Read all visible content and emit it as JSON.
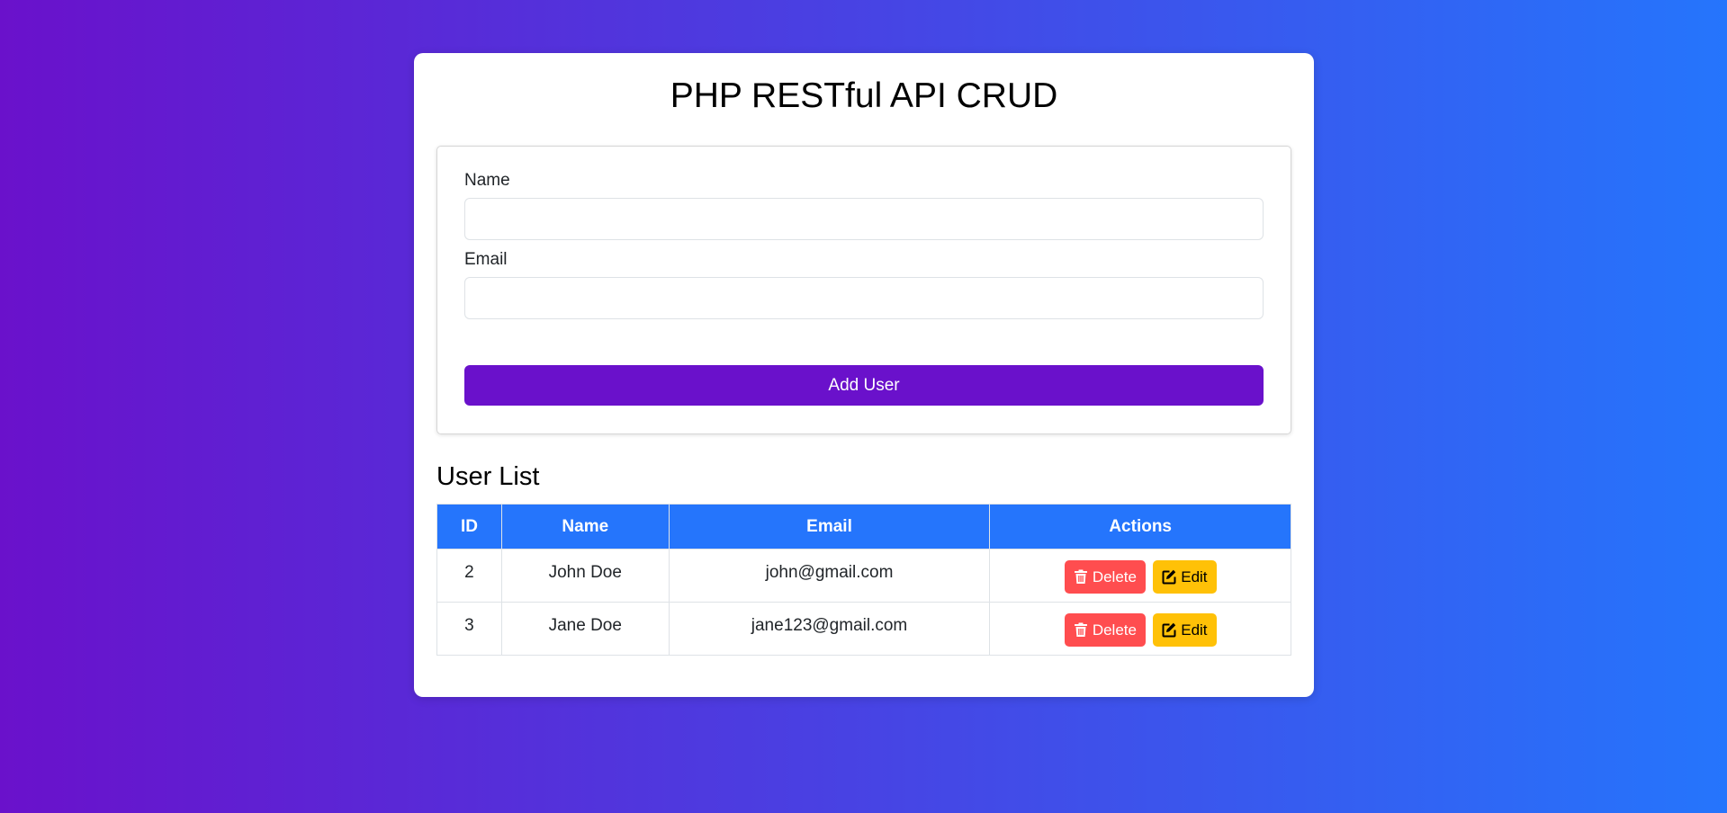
{
  "page": {
    "title": "PHP RESTful API CRUD"
  },
  "form": {
    "name_label": "Name",
    "name_value": "",
    "email_label": "Email",
    "email_value": "",
    "submit_label": "Add User"
  },
  "list": {
    "title": "User List",
    "columns": [
      "ID",
      "Name",
      "Email",
      "Actions"
    ],
    "rows": [
      {
        "id": "2",
        "name": "John Doe",
        "email": "john@gmail.com"
      },
      {
        "id": "3",
        "name": "Jane Doe",
        "email": "jane123@gmail.com"
      }
    ],
    "delete_label": "Delete",
    "edit_label": "Edit"
  },
  "icons": {
    "delete": "trash-icon",
    "edit": "edit-icon"
  },
  "colors": {
    "gradient_start": "#6a11cb",
    "gradient_end": "#2575fc",
    "add_button": "#6a11cb",
    "table_header": "#2575fc",
    "delete_button": "#ff4d4f",
    "edit_button": "#ffc107"
  }
}
